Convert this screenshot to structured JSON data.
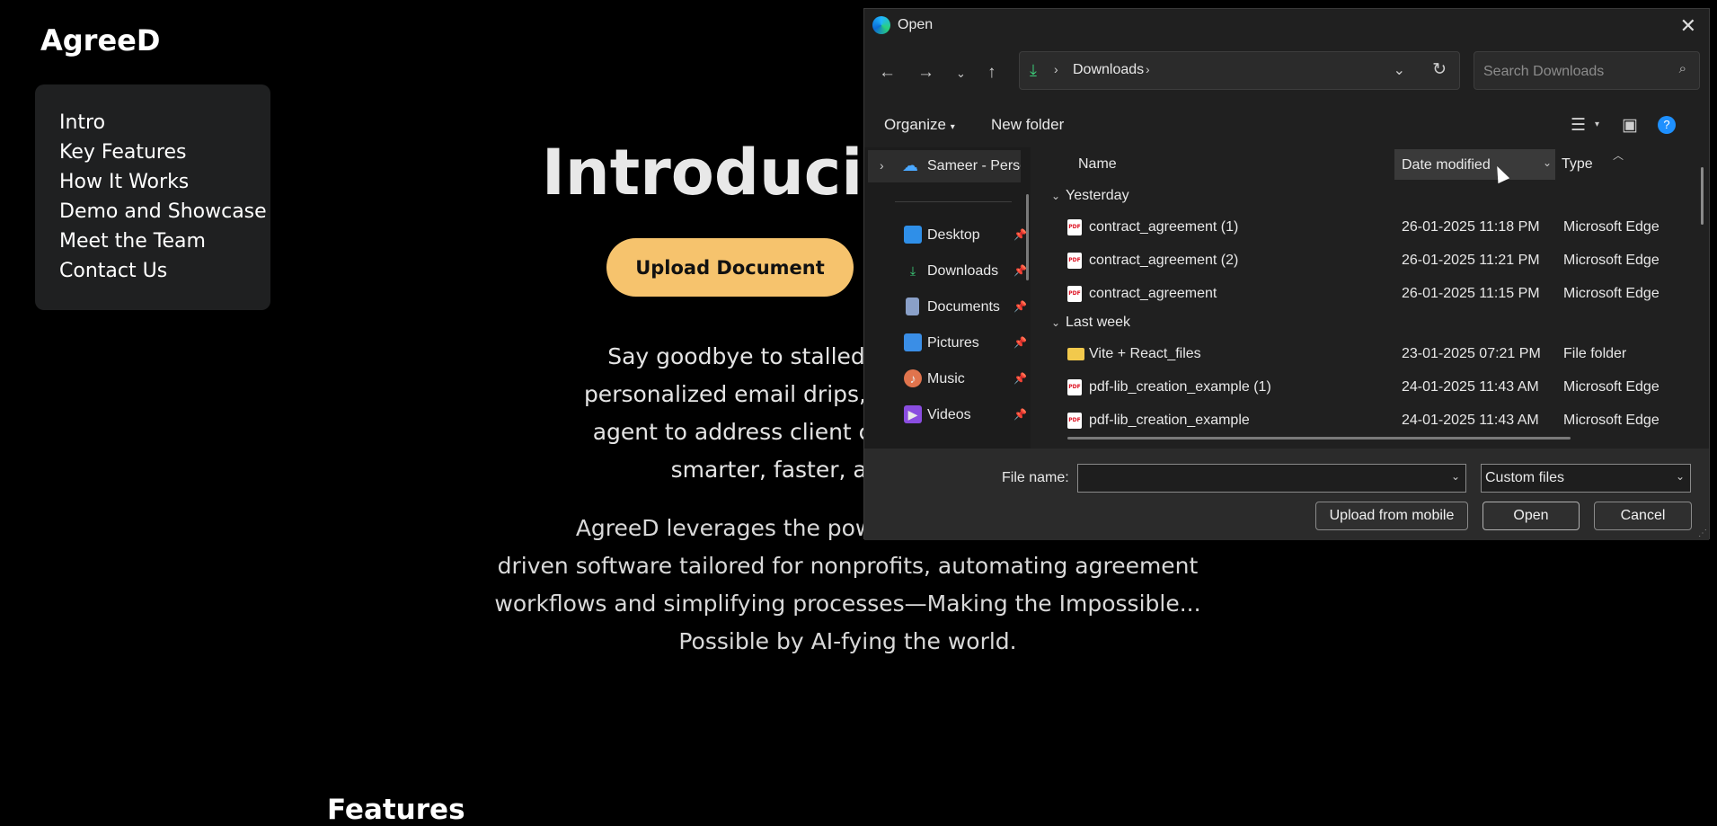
{
  "page": {
    "brand": "AgreeD",
    "nav": [
      "Intro",
      "Key Features",
      "How It Works",
      "Demo and Showcase",
      "Meet the Team",
      "Contact Us"
    ],
    "hero_title": "Introducin",
    "upload_button": "Upload Document",
    "para1_lines": [
      "Say goodbye to stalled agreem",
      "personalized email drips, automate",
      "agent to address client concerns i",
      "smarter, faster, and"
    ],
    "para2_lines": [
      "AgreeD leverages the power of Docu",
      "driven software tailored for nonprofits, automating agreement",
      "workflows and simplifying processes—Making the Impossible...",
      "Possible by AI-fying the world."
    ],
    "features_heading": "Features"
  },
  "dialog": {
    "title": "Open",
    "address": {
      "crumb": "Downloads"
    },
    "search_placeholder": "Search Downloads",
    "commands": {
      "organize": "Organize",
      "new_folder": "New folder"
    },
    "nav_pane": {
      "onedrive": "Sameer - Perso",
      "items": [
        {
          "label": "Desktop",
          "icon": "desktop-icon",
          "color": "#2f8fe8"
        },
        {
          "label": "Downloads",
          "icon": "downloads-icon",
          "color": "#3ccf7a"
        },
        {
          "label": "Documents",
          "icon": "documents-icon",
          "color": "#8aa0c8"
        },
        {
          "label": "Pictures",
          "icon": "pictures-icon",
          "color": "#3a8ee6"
        },
        {
          "label": "Music",
          "icon": "music-icon",
          "color": "#e0744d"
        },
        {
          "label": "Videos",
          "icon": "videos-icon",
          "color": "#8a4de0"
        }
      ]
    },
    "columns": {
      "name": "Name",
      "date": "Date modified",
      "type": "Type"
    },
    "groups": [
      {
        "label": "Yesterday",
        "files": [
          {
            "name": "contract_agreement (1)",
            "date": "26-01-2025 11:18 PM",
            "type": "Microsoft Edge",
            "kind": "pdf"
          },
          {
            "name": "contract_agreement (2)",
            "date": "26-01-2025 11:21 PM",
            "type": "Microsoft Edge",
            "kind": "pdf"
          },
          {
            "name": "contract_agreement",
            "date": "26-01-2025 11:15 PM",
            "type": "Microsoft Edge",
            "kind": "pdf"
          }
        ]
      },
      {
        "label": "Last week",
        "files": [
          {
            "name": "Vite + React_files",
            "date": "23-01-2025 07:21 PM",
            "type": "File folder",
            "kind": "folder"
          },
          {
            "name": "pdf-lib_creation_example (1)",
            "date": "24-01-2025 11:43 AM",
            "type": "Microsoft Edge",
            "kind": "pdf"
          },
          {
            "name": "pdf-lib_creation_example",
            "date": "24-01-2025 11:43 AM",
            "type": "Microsoft Edge",
            "kind": "pdf"
          }
        ]
      }
    ],
    "file_name_label": "File name:",
    "file_name_value": "",
    "filter": "Custom files",
    "buttons": {
      "upload_mobile": "Upload from mobile",
      "open": "Open",
      "cancel": "Cancel"
    }
  }
}
